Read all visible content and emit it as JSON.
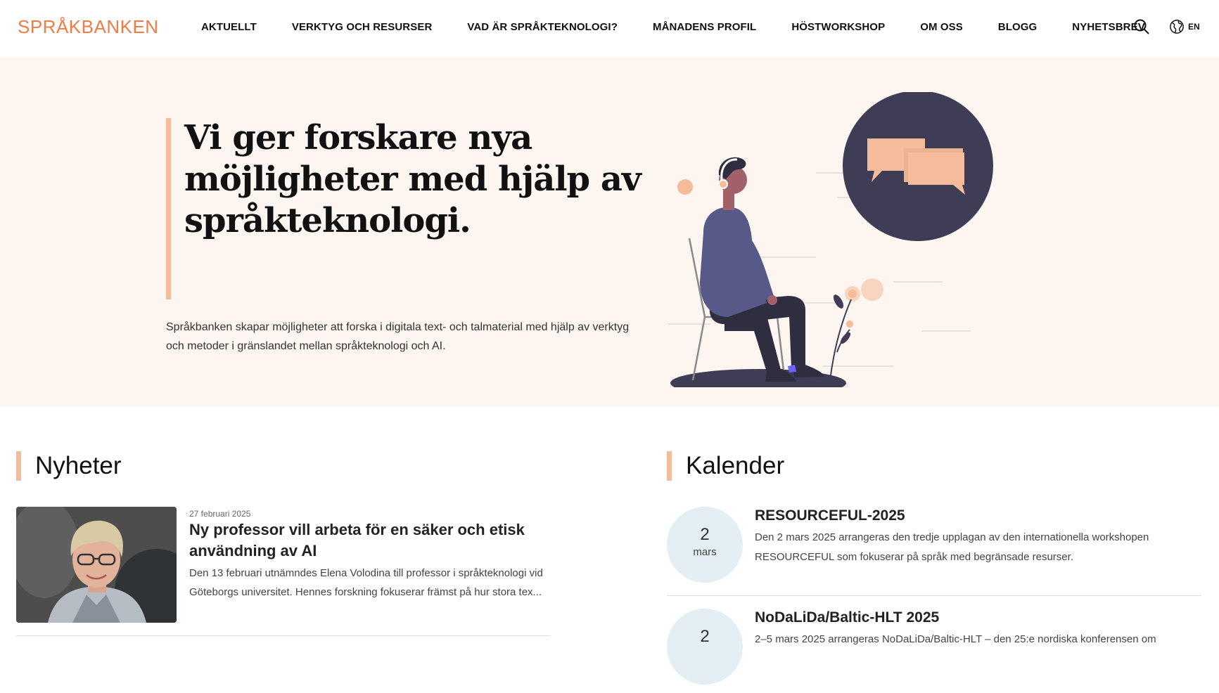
{
  "header": {
    "logo": "SPRÅKBANKEN",
    "nav": [
      {
        "label": "AKTUELLT"
      },
      {
        "label": "VERKTYG OCH RESURSER"
      },
      {
        "label": "VAD ÄR SPRÅKTEKNOLOGI?"
      },
      {
        "label": "MÅNADENS PROFIL"
      },
      {
        "label": "HÖSTWORKSHOP"
      },
      {
        "label": "OM OSS"
      },
      {
        "label": "BLOGG"
      },
      {
        "label": "NYHETSBREV"
      }
    ],
    "search_icon": "search-icon",
    "language_icon": "globe-icon",
    "language_label": "EN"
  },
  "hero": {
    "title": "Vi ger forskare nya möjligheter med hjälp av språkteknologi.",
    "text": "Språkbanken skapar möjligheter att forska i digitala text- och talmaterial med hjälp av verktyg och metoder i gränslandet mellan språkteknologi och AI."
  },
  "news": {
    "heading": "Nyheter",
    "items": [
      {
        "date": "27 februari 2025",
        "title": "Ny professor vill arbeta för en säker och etisk användning av AI",
        "summary": "Den 13 februari utnämndes Elena Volodina till professor i språkteknologi vid Göteborgs universitet. Hennes forskning fokuserar främst på hur stora tex..."
      }
    ]
  },
  "calendar": {
    "heading": "Kalender",
    "items": [
      {
        "day": "2",
        "month": "mars",
        "title": "RESOURCEFUL-2025",
        "description": "Den 2 mars 2025 arrangeras den tredje upplagan av den internationella workshopen RESOURCEFUL som fokuserar på språk med begränsade resurser."
      },
      {
        "day": "2",
        "month": "",
        "title": "NoDaLiDa/Baltic-HLT 2025",
        "description": "2–5 mars 2025 arrangeras NoDaLiDa/Baltic-HLT – den 25:e nordiska konferensen om"
      }
    ]
  },
  "colors": {
    "brand": "#ef7c45",
    "accent_bar": "#f4bc9a",
    "hero_background": "#fdf5f0",
    "calendar_badge": "#e3eff2",
    "illustration_dark": "#3f3d56",
    "illustration_skin": "#f4bc9a"
  }
}
